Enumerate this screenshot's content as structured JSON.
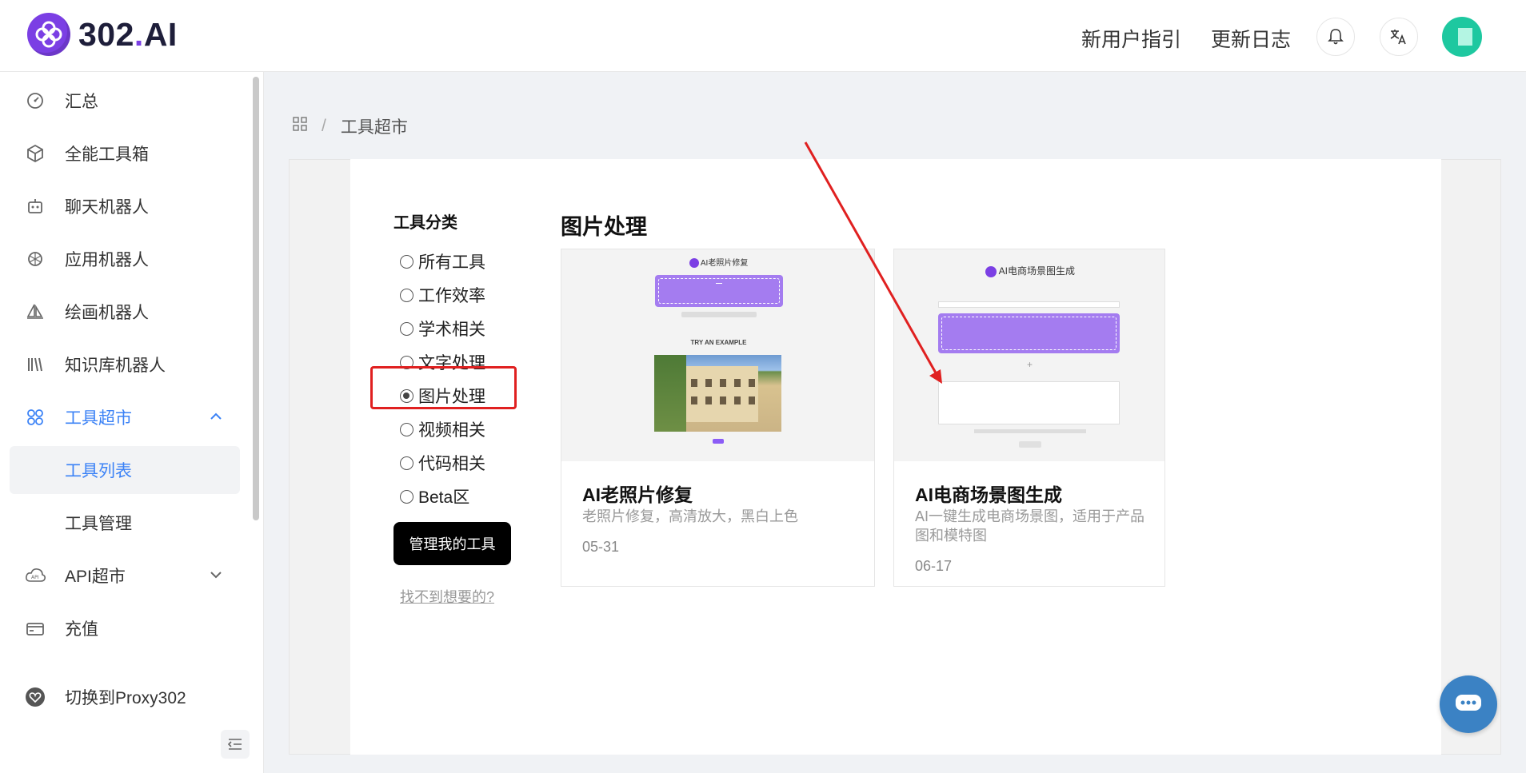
{
  "header": {
    "logo_text_main": "302",
    "logo_text_dot": ".",
    "logo_text_ai": "AI",
    "links": [
      "新用户指引",
      "更新日志"
    ],
    "icons": [
      "bell-icon",
      "translate-icon"
    ]
  },
  "sidebar": {
    "items": [
      {
        "label": "汇总",
        "icon": "dashboard-icon"
      },
      {
        "label": "全能工具箱",
        "icon": "cube-icon"
      },
      {
        "label": "聊天机器人",
        "icon": "robot-icon"
      },
      {
        "label": "应用机器人",
        "icon": "openai-icon"
      },
      {
        "label": "绘画机器人",
        "icon": "sailboat-icon"
      },
      {
        "label": "知识库机器人",
        "icon": "books-icon"
      },
      {
        "label": "工具超市",
        "icon": "apps-icon",
        "active": true,
        "expanded": true
      },
      {
        "label": "工具列表",
        "sub": true,
        "selected": true
      },
      {
        "label": "工具管理",
        "sub": true
      },
      {
        "label": "API超市",
        "icon": "api-cloud-icon",
        "expandable": true
      },
      {
        "label": "充值",
        "icon": "wallet-icon"
      },
      {
        "label": "切换到Proxy302",
        "icon": "switch-icon"
      }
    ]
  },
  "breadcrumb": {
    "home_icon": "grid-icon",
    "separator": "/",
    "current": "工具超市"
  },
  "categories": {
    "title": "工具分类",
    "options": [
      "所有工具",
      "工作效率",
      "学术相关",
      "文字处理",
      "图片处理",
      "视频相关",
      "代码相关",
      "Beta区"
    ],
    "selected": "图片处理",
    "manage_button": "管理我的工具",
    "help_link": "找不到想要的?"
  },
  "section": {
    "title": "图片处理",
    "cards": [
      {
        "title": "AI老照片修复",
        "desc": "老照片修复，高清放大，黑白上色",
        "date": "05-31",
        "thumb_title": "AI老照片修复",
        "thumb_example": "TRY AN EXAMPLE"
      },
      {
        "title": "AI电商场景图生成",
        "desc": "AI一键生成电商场景图，适用于产品图和模特图",
        "date": "06-17",
        "thumb_title": "AI电商场景图生成"
      }
    ]
  },
  "colors": {
    "accent": "#3b82f6",
    "brand": "#7b3fe4",
    "highlight": "#e02020",
    "upload": "#a47cf0"
  }
}
